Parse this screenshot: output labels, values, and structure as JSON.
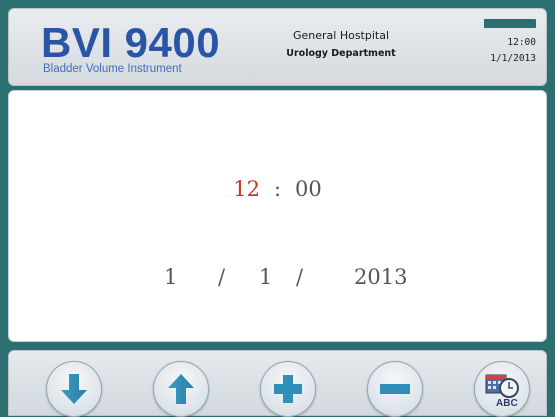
{
  "header": {
    "brand_title": "BVI 9400",
    "brand_subtitle": "Bladder Volume Instrument",
    "facility_name": "General Hostpital",
    "department": "Urology Department",
    "status_time": "12:00",
    "status_date": "1/1/2013",
    "battery_icon": "battery-icon"
  },
  "editor": {
    "hour": "12",
    "time_separator": ":",
    "minute": "00",
    "month": "1",
    "date_separator_1": "/",
    "day": "1",
    "date_separator_2": "/",
    "year": "2013",
    "active_field": "hour",
    "active_color": "#c8381b"
  },
  "toolbar": {
    "buttons": [
      {
        "name": "down-button",
        "icon": "arrow-down-icon"
      },
      {
        "name": "up-button",
        "icon": "arrow-up-icon"
      },
      {
        "name": "increment-button",
        "icon": "plus-icon"
      },
      {
        "name": "decrement-button",
        "icon": "minus-icon"
      },
      {
        "name": "date-time-format-button",
        "icon": "calendar-clock-abc-icon",
        "label": "ABC"
      }
    ]
  },
  "colors": {
    "frame": "#2b6f70",
    "brand": "#2a55a4",
    "icon_blue": "#2f8fb8"
  }
}
